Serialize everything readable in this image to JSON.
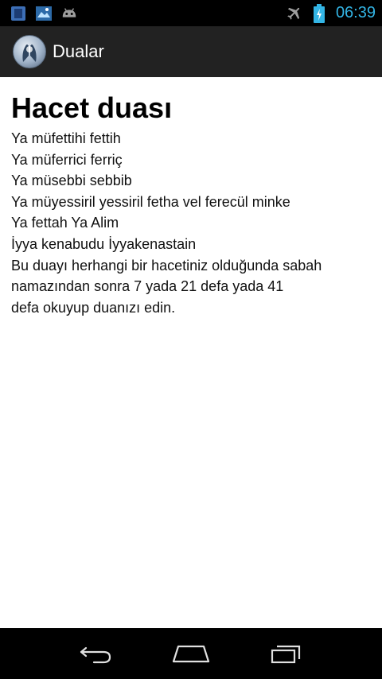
{
  "status_bar": {
    "time": "06:39",
    "colors": {
      "clock": "#33b5e5",
      "battery": "#33b5e5"
    },
    "icons": [
      "app-notification-icon",
      "image-notification-icon",
      "android-notification-icon",
      "airplane-mode-icon",
      "battery-charging-icon"
    ]
  },
  "action_bar": {
    "title": "Dualar",
    "icon": "app-logo-icon"
  },
  "content": {
    "title": "Hacet duası",
    "lines": [
      "Ya müfettihi fettih",
      "Ya müferrici ferriç",
      "Ya müsebbi sebbib",
      "Ya müyessiril yessiril fetha vel ferecül minke",
      "Ya fettah Ya Alim",
      "İyya kenabudu İyyakenastain",
      "Bu duayı herhangi bir hacetiniz olduğunda  sabah",
      "namazından sonra 7 yada 21 defa yada 41",
      "defa okuyup duanızı edin."
    ]
  },
  "nav_bar": {
    "buttons": [
      "back-icon",
      "home-icon",
      "recent-apps-icon"
    ]
  }
}
